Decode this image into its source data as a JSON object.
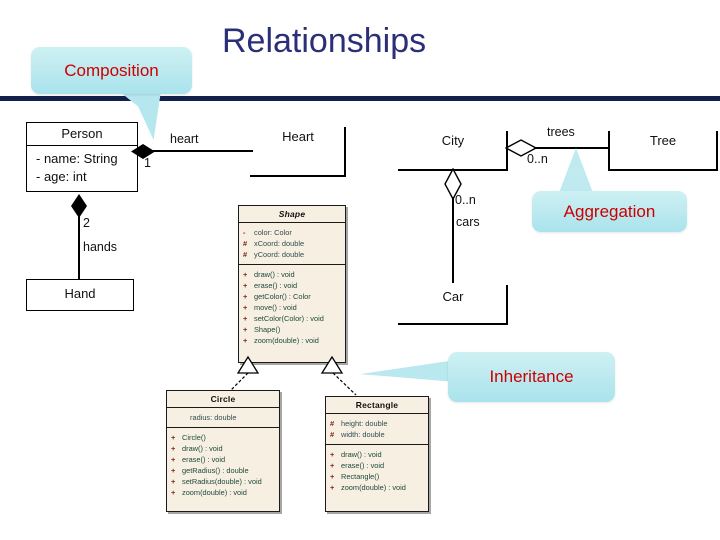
{
  "slide": {
    "title": "Relationships"
  },
  "callouts": [
    {
      "id": "composition",
      "label": "Composition"
    },
    {
      "id": "aggregation",
      "label": "Aggregation"
    },
    {
      "id": "inheritance",
      "label": "Inheritance"
    }
  ],
  "plain_boxes": {
    "person": {
      "name": "Person",
      "attributes": [
        "- name: String",
        "- age: int"
      ]
    },
    "hand": {
      "name": "Hand"
    },
    "heart": {
      "name": "Heart"
    },
    "city": {
      "name": "City"
    },
    "tree": {
      "name": "Tree"
    },
    "car": {
      "name": "Car"
    }
  },
  "class_boxes": {
    "shape": {
      "name": "Shape",
      "attributes": [
        {
          "visibility": "-",
          "text": "color: Color"
        },
        {
          "visibility": "#",
          "text": "xCoord: double"
        },
        {
          "visibility": "#",
          "text": "yCoord: double"
        }
      ],
      "methods": [
        {
          "visibility": "+",
          "text": "draw() : void"
        },
        {
          "visibility": "+",
          "text": "erase() : void"
        },
        {
          "visibility": "+",
          "text": "getColor() : Color"
        },
        {
          "visibility": "+",
          "text": "move() : void"
        },
        {
          "visibility": "+",
          "text": "setColor(Color) : void"
        },
        {
          "visibility": "+",
          "text": "Shape()"
        },
        {
          "visibility": "+",
          "text": "zoom(double) : void"
        }
      ]
    },
    "circle": {
      "name": "Circle",
      "attributes": [
        {
          "visibility": "",
          "text": "radius: double"
        }
      ],
      "methods": [
        {
          "visibility": "+",
          "text": "Circle()"
        },
        {
          "visibility": "+",
          "text": "draw() : void"
        },
        {
          "visibility": "+",
          "text": "erase() : void"
        },
        {
          "visibility": "+",
          "text": "getRadius() : double"
        },
        {
          "visibility": "+",
          "text": "setRadius(double) : void"
        },
        {
          "visibility": "+",
          "text": "zoom(double) : void"
        }
      ]
    },
    "rectangle": {
      "name": "Rectangle",
      "attributes": [
        {
          "visibility": "#",
          "text": "height: double"
        },
        {
          "visibility": "#",
          "text": "width: double"
        }
      ],
      "methods": [
        {
          "visibility": "+",
          "text": "draw() : void"
        },
        {
          "visibility": "+",
          "text": "erase() : void"
        },
        {
          "visibility": "+",
          "text": "Rectangle()"
        },
        {
          "visibility": "+",
          "text": "zoom(double) : void"
        }
      ]
    }
  },
  "relationships": {
    "person_heart": {
      "role": "heart",
      "multiplicity": "1"
    },
    "person_hand": {
      "role": "hands",
      "multiplicity": "2"
    },
    "city_trees": {
      "role": "trees",
      "multiplicity": "0..n"
    },
    "city_cars": {
      "role": "cars",
      "multiplicity": "0..n"
    }
  },
  "colors": {
    "title": "#2b2f78",
    "rule": "#13204a",
    "callout_text": "#cc0000",
    "callout_fill": "#bfeaf0",
    "class_fill": "#f7efe2"
  }
}
